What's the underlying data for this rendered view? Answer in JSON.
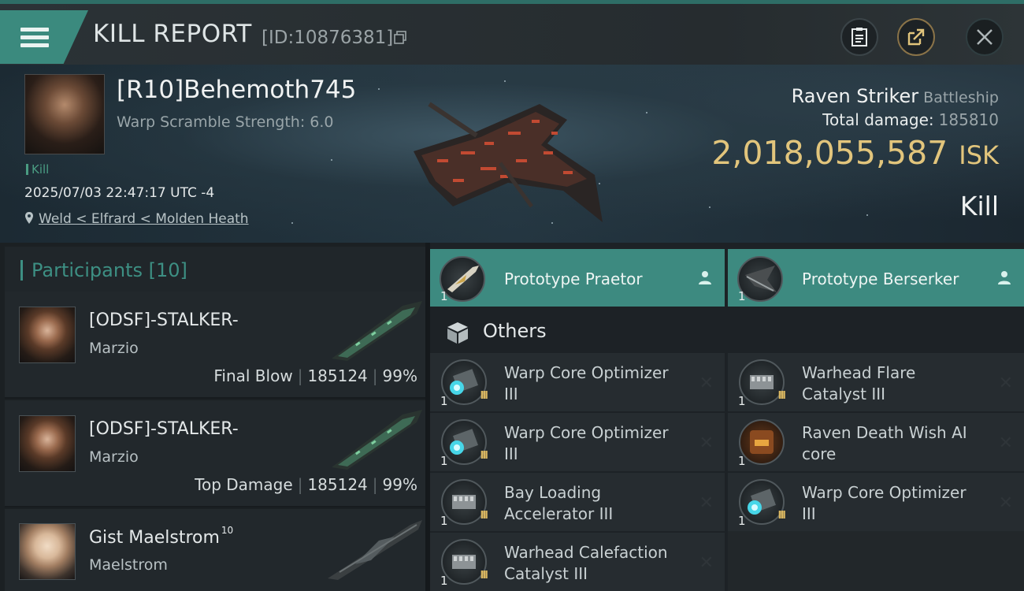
{
  "header": {
    "title": "KILL REPORT",
    "report_id": "[ID:10876381]"
  },
  "victim": {
    "name": "[R10]Behemoth745",
    "warp_scramble": "Warp Scramble Strength: 6.0",
    "kill_tag": "Kill",
    "datetime": "2025/07/03 22:47:17 UTC -4",
    "location": "Weld < Elfrard < Molden Heath",
    "ship_name": "Raven Striker",
    "ship_class": "Battleship",
    "total_damage_label": "Total damage:",
    "total_damage": "185810",
    "isk_value": "2,018,055,587",
    "isk_unit": "ISK",
    "result": "Kill"
  },
  "participants": {
    "label": "Participants",
    "count": "[10]",
    "rows": [
      {
        "name": "[ODSF]-STALKER-",
        "corp": "Marzio",
        "role": "Final Blow",
        "damage": "185124",
        "percent": "99%",
        "sup": ""
      },
      {
        "name": "[ODSF]-STALKER-",
        "corp": "Marzio",
        "role": "Top Damage",
        "damage": "185124",
        "percent": "99%",
        "sup": ""
      },
      {
        "name": "Gist Maelstrom",
        "corp": "Maelstrom",
        "role": "",
        "damage": "",
        "percent": "",
        "sup": "10"
      }
    ]
  },
  "attackers": [
    {
      "qty": "1",
      "label": "Prototype  Praetor"
    },
    {
      "qty": "1",
      "label": "Prototype  Berserker"
    }
  ],
  "others_label": "Others",
  "items": [
    {
      "qty": "1",
      "line1": "Warp Core Optimizer",
      "line2": "III",
      "tier": "III",
      "icon": "warp-core-icon"
    },
    {
      "qty": "1",
      "line1": "Warhead Flare",
      "line2": "Catalyst III",
      "tier": "III",
      "icon": "warhead-icon"
    },
    {
      "qty": "1",
      "line1": "Warp Core Optimizer",
      "line2": "III",
      "tier": "III",
      "icon": "warp-core-icon"
    },
    {
      "qty": "1",
      "line1": "Raven Death Wish AI",
      "line2": "core",
      "tier": "",
      "icon": "ai-core-icon"
    },
    {
      "qty": "1",
      "line1": "Bay Loading",
      "line2": "Accelerator III",
      "tier": "III",
      "icon": "bay-loading-icon"
    },
    {
      "qty": "1",
      "line1": "Warp Core Optimizer",
      "line2": "III",
      "tier": "III",
      "icon": "warp-core-icon"
    },
    {
      "qty": "1",
      "line1": "Warhead Calefaction",
      "line2": "Catalyst III",
      "tier": "III",
      "icon": "warhead-icon"
    }
  ],
  "colors": {
    "accent_teal": "#3d8a80",
    "isk_gold": "#e2c57c",
    "tier_gold": "#d9b660"
  }
}
